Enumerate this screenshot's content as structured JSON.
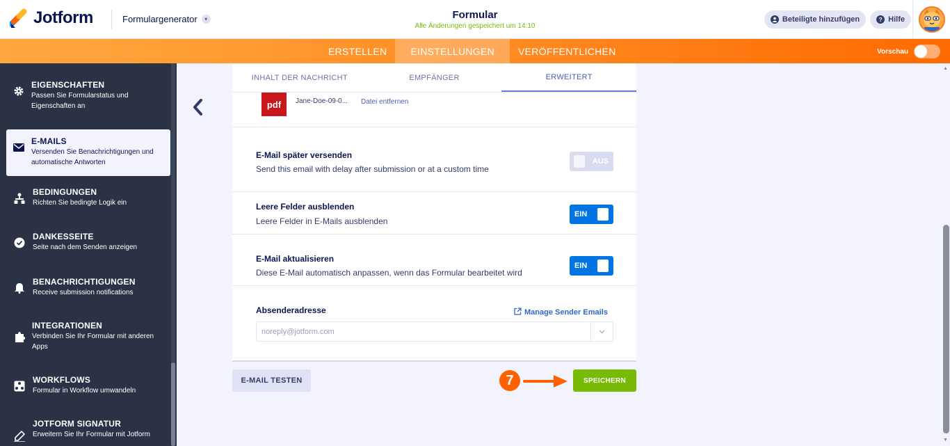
{
  "app": {
    "logo_text": "Jotform",
    "form_generator": "Formulargenerator",
    "title": "Formular",
    "save_status": "Alle Änderungen gespeichert um 14:10",
    "add_participants": "Beteiligte hinzufügen",
    "help": "Hilfe"
  },
  "nav": {
    "tabs": [
      {
        "label": "ERSTELLEN"
      },
      {
        "label": "EINSTELLUNGEN"
      },
      {
        "label": "VERÖFFENTLICHEN"
      }
    ],
    "preview_label": "Vorschau"
  },
  "sidebar": {
    "items": [
      {
        "title": "EIGENSCHAFTEN",
        "desc": "Passen Sie Formularstatus und Eigenschaften an",
        "icon": "gear-icon"
      },
      {
        "title": "E-MAILS",
        "desc": "Versenden Sie Benachrichtigungen und automatische Antworten",
        "icon": "envelope-icon"
      },
      {
        "title": "BEDINGUNGEN",
        "desc": "Richten Sie bedingte Logik ein",
        "icon": "hierarchy-icon"
      },
      {
        "title": "DANKESSEITE",
        "desc": "Seite nach dem Senden anzeigen",
        "icon": "check-circle-icon"
      },
      {
        "title": "BENACHRICHTIGUNGEN",
        "desc": "Receive submission notifications",
        "icon": "bell-icon"
      },
      {
        "title": "INTEGRATIONEN",
        "desc": "Verbinden Sie Ihr Formular mit anderen Apps",
        "icon": "puzzle-icon"
      },
      {
        "title": "WORKFLOWS",
        "desc": "Formular in Workflow umwandeln",
        "icon": "workflow-icon"
      },
      {
        "title": "JOTFORM SIGNATUR",
        "desc": "Erweitern Sie Ihr Formular mit Jotform",
        "icon": "pen-icon"
      }
    ]
  },
  "email_settings": {
    "subtabs": [
      {
        "label": "INHALT DER NACHRICHT"
      },
      {
        "label": "EMPFÄNGER"
      },
      {
        "label": "ERWEITERT"
      }
    ],
    "attachment": {
      "icon_label": "pdf",
      "file_name": "Jane-Doe-09-0...",
      "remove_label": "Datei entfernen"
    },
    "options": [
      {
        "title": "E-Mail später versenden",
        "desc": "Send this email with delay after submission or at a custom time",
        "state_label": "AUS"
      },
      {
        "title": "Leere Felder ausblenden",
        "desc": "Leere Felder in E-Mails ausblenden",
        "state_label": "EIN"
      },
      {
        "title": "E-Mail aktualisieren",
        "desc": "Diese E-Mail automatisch anpassen, wenn das Formular bearbeitet wird",
        "state_label": "EIN"
      }
    ],
    "sender": {
      "label": "Absenderadresse",
      "manage_label": "Manage Sender Emails",
      "value": "noreply@jotform.com"
    }
  },
  "actions": {
    "test_label": "E-MAIL TESTEN",
    "save_label": "SPEICHERN",
    "step_number": "7"
  },
  "colors": {
    "brand_orange": "#ff6100",
    "save_green": "#78bb07",
    "toggle_blue": "#0075e3",
    "sidebar_bg": "#2b3245"
  }
}
